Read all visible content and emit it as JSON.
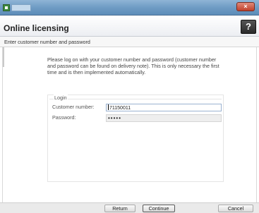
{
  "window": {
    "tab_label": "",
    "close_label": "×"
  },
  "header": {
    "title": "Online licensing",
    "help_label": "?"
  },
  "subheader": {
    "text": "Enter customer number and password"
  },
  "info": {
    "text": "Please log on with your customer number and password (customer number and password can be found on delivery note). This is only necessary the first time and is then implemented automatically."
  },
  "login": {
    "legend": "Login",
    "customer_number_label": "Customer number:",
    "customer_number_value": "71150011",
    "password_label": "Password:",
    "password_value": "•••••"
  },
  "footer": {
    "return_label": "Return",
    "continue_label": "Continue",
    "cancel_label": "Cancel"
  }
}
